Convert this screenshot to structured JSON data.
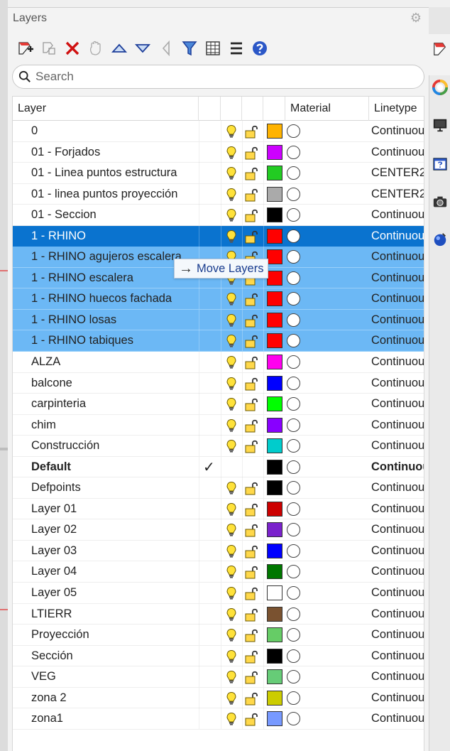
{
  "panel": {
    "title": "Layers"
  },
  "toolbar": {
    "buttons": [
      {
        "name": "new-layer-icon"
      },
      {
        "name": "new-sublayer-icon"
      },
      {
        "name": "delete-icon"
      },
      {
        "name": "hand-icon"
      },
      {
        "name": "move-up-icon"
      },
      {
        "name": "move-down-icon"
      },
      {
        "name": "move-left-icon"
      },
      {
        "name": "filter-icon"
      },
      {
        "name": "table-icon"
      },
      {
        "name": "menu-icon"
      },
      {
        "name": "help-icon"
      }
    ]
  },
  "search": {
    "placeholder": "Search"
  },
  "columns": {
    "layer": "Layer",
    "material": "Material",
    "linetype": "Linetype"
  },
  "tooltip": {
    "arrow": "→",
    "text": "Move Layers"
  },
  "rows": [
    {
      "name": "0",
      "color": "#ffb300",
      "linetype": "Continuous",
      "state": "normal"
    },
    {
      "name": "01 - Forjados",
      "color": "#cc00ff",
      "linetype": "Continuous",
      "state": "normal"
    },
    {
      "name": "01 - Linea puntos estructura",
      "color": "#22cc22",
      "linetype": "CENTER2",
      "state": "normal"
    },
    {
      "name": "01 - linea puntos proyección",
      "color": "#aaaaaa",
      "linetype": "CENTER2",
      "state": "normal"
    },
    {
      "name": "01 - Seccion",
      "color": "#000000",
      "linetype": "Continuous",
      "state": "normal"
    },
    {
      "name": "1 - RHINO",
      "color": "#ff0000",
      "linetype": "Continuous",
      "state": "primary"
    },
    {
      "name": "1 - RHINO agujeros escalera",
      "color": "#ff0000",
      "linetype": "Continuous",
      "state": "selected"
    },
    {
      "name": "1 - RHINO escalera",
      "color": "#ff0000",
      "linetype": "Continuous",
      "state": "selected"
    },
    {
      "name": "1 - RHINO huecos fachada",
      "color": "#ff0000",
      "linetype": "Continuous",
      "state": "selected"
    },
    {
      "name": "1 - RHINO losas",
      "color": "#ff0000",
      "linetype": "Continuous",
      "state": "selected"
    },
    {
      "name": "1 - RHINO tabiques",
      "color": "#ff0000",
      "linetype": "Continuous",
      "state": "selected"
    },
    {
      "name": "ALZA",
      "color": "#ff00ee",
      "linetype": "Continuous",
      "state": "normal"
    },
    {
      "name": "balcone",
      "color": "#0000ff",
      "linetype": "Continuous",
      "state": "normal"
    },
    {
      "name": "carpinteria",
      "color": "#00ff00",
      "linetype": "Continuous",
      "state": "normal"
    },
    {
      "name": "chim",
      "color": "#8800ff",
      "linetype": "Continuous",
      "state": "normal"
    },
    {
      "name": "Construcción",
      "color": "#00cccc",
      "linetype": "Continuous",
      "state": "normal"
    },
    {
      "name": "Default",
      "color": "#000000",
      "linetype": "Continuous",
      "state": "default",
      "current": "✓"
    },
    {
      "name": "Defpoints",
      "color": "#000000",
      "linetype": "Continuous",
      "state": "normal"
    },
    {
      "name": "Layer 01",
      "color": "#cc0000",
      "linetype": "Continuous",
      "state": "normal"
    },
    {
      "name": "Layer 02",
      "color": "#7a22cc",
      "linetype": "Continuous",
      "state": "normal"
    },
    {
      "name": "Layer 03",
      "color": "#0000ff",
      "linetype": "Continuous",
      "state": "normal"
    },
    {
      "name": "Layer 04",
      "color": "#007700",
      "linetype": "Continuous",
      "state": "normal"
    },
    {
      "name": "Layer 05",
      "color": "#ffffff",
      "linetype": "Continuous",
      "state": "normal"
    },
    {
      "name": "LTIERR",
      "color": "#7a5230",
      "linetype": "Continuous",
      "state": "normal"
    },
    {
      "name": "Proyección",
      "color": "#66cc66",
      "linetype": "Continuous",
      "state": "normal"
    },
    {
      "name": "Sección",
      "color": "#000000",
      "linetype": "Continuous",
      "state": "normal"
    },
    {
      "name": "VEG",
      "color": "#66cc77",
      "linetype": "Continuous",
      "state": "normal"
    },
    {
      "name": "zona 2",
      "color": "#cccc00",
      "linetype": "Continuous",
      "state": "normal"
    },
    {
      "name": "zona1",
      "color": "#7799ff",
      "linetype": "Continuous",
      "state": "normal"
    }
  ],
  "side_panel_tabs": [
    {
      "name": "layers-tab-icon"
    },
    {
      "name": "color-wheel-icon"
    },
    {
      "name": "display-icon"
    },
    {
      "name": "help-panel-icon"
    },
    {
      "name": "camera-icon"
    },
    {
      "name": "render-sphere-icon"
    }
  ]
}
